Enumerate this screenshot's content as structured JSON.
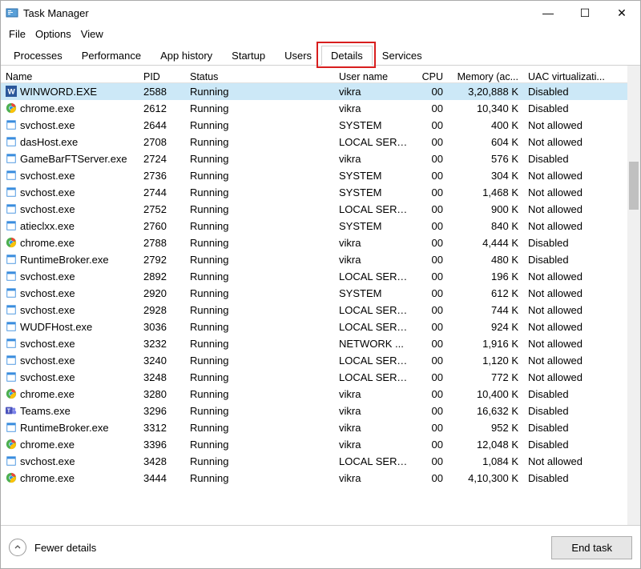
{
  "window": {
    "title": "Task Manager"
  },
  "winctrl": {
    "min": "—",
    "max": "☐",
    "close": "✕"
  },
  "menu": {
    "file": "File",
    "options": "Options",
    "view": "View"
  },
  "tabs": {
    "processes": "Processes",
    "performance": "Performance",
    "apphistory": "App history",
    "startup": "Startup",
    "users": "Users",
    "details": "Details",
    "services": "Services"
  },
  "columns": {
    "name": "Name",
    "pid": "PID",
    "status": "Status",
    "user": "User name",
    "cpu": "CPU",
    "memory": "Memory (ac...",
    "uac": "UAC virtualizati..."
  },
  "footer": {
    "fewer": "Fewer details",
    "endtask": "End task"
  },
  "rows": [
    {
      "icon": "word",
      "name": "WINWORD.EXE",
      "pid": "2588",
      "status": "Running",
      "user": "vikra",
      "cpu": "00",
      "mem": "3,20,888 K",
      "uac": "Disabled",
      "sel": true
    },
    {
      "icon": "chrome",
      "name": "chrome.exe",
      "pid": "2612",
      "status": "Running",
      "user": "vikra",
      "cpu": "00",
      "mem": "10,340 K",
      "uac": "Disabled"
    },
    {
      "icon": "generic",
      "name": "svchost.exe",
      "pid": "2644",
      "status": "Running",
      "user": "SYSTEM",
      "cpu": "00",
      "mem": "400 K",
      "uac": "Not allowed"
    },
    {
      "icon": "generic",
      "name": "dasHost.exe",
      "pid": "2708",
      "status": "Running",
      "user": "LOCAL SERV...",
      "cpu": "00",
      "mem": "604 K",
      "uac": "Not allowed"
    },
    {
      "icon": "generic",
      "name": "GameBarFTServer.exe",
      "pid": "2724",
      "status": "Running",
      "user": "vikra",
      "cpu": "00",
      "mem": "576 K",
      "uac": "Disabled"
    },
    {
      "icon": "generic",
      "name": "svchost.exe",
      "pid": "2736",
      "status": "Running",
      "user": "SYSTEM",
      "cpu": "00",
      "mem": "304 K",
      "uac": "Not allowed"
    },
    {
      "icon": "generic",
      "name": "svchost.exe",
      "pid": "2744",
      "status": "Running",
      "user": "SYSTEM",
      "cpu": "00",
      "mem": "1,468 K",
      "uac": "Not allowed"
    },
    {
      "icon": "generic",
      "name": "svchost.exe",
      "pid": "2752",
      "status": "Running",
      "user": "LOCAL SERV...",
      "cpu": "00",
      "mem": "900 K",
      "uac": "Not allowed"
    },
    {
      "icon": "generic",
      "name": "atieclxx.exe",
      "pid": "2760",
      "status": "Running",
      "user": "SYSTEM",
      "cpu": "00",
      "mem": "840 K",
      "uac": "Not allowed"
    },
    {
      "icon": "chrome",
      "name": "chrome.exe",
      "pid": "2788",
      "status": "Running",
      "user": "vikra",
      "cpu": "00",
      "mem": "4,444 K",
      "uac": "Disabled"
    },
    {
      "icon": "generic",
      "name": "RuntimeBroker.exe",
      "pid": "2792",
      "status": "Running",
      "user": "vikra",
      "cpu": "00",
      "mem": "480 K",
      "uac": "Disabled"
    },
    {
      "icon": "generic",
      "name": "svchost.exe",
      "pid": "2892",
      "status": "Running",
      "user": "LOCAL SERV...",
      "cpu": "00",
      "mem": "196 K",
      "uac": "Not allowed"
    },
    {
      "icon": "generic",
      "name": "svchost.exe",
      "pid": "2920",
      "status": "Running",
      "user": "SYSTEM",
      "cpu": "00",
      "mem": "612 K",
      "uac": "Not allowed"
    },
    {
      "icon": "generic",
      "name": "svchost.exe",
      "pid": "2928",
      "status": "Running",
      "user": "LOCAL SERV...",
      "cpu": "00",
      "mem": "744 K",
      "uac": "Not allowed"
    },
    {
      "icon": "generic",
      "name": "WUDFHost.exe",
      "pid": "3036",
      "status": "Running",
      "user": "LOCAL SERV...",
      "cpu": "00",
      "mem": "924 K",
      "uac": "Not allowed"
    },
    {
      "icon": "generic",
      "name": "svchost.exe",
      "pid": "3232",
      "status": "Running",
      "user": "NETWORK ...",
      "cpu": "00",
      "mem": "1,916 K",
      "uac": "Not allowed"
    },
    {
      "icon": "generic",
      "name": "svchost.exe",
      "pid": "3240",
      "status": "Running",
      "user": "LOCAL SERV...",
      "cpu": "00",
      "mem": "1,120 K",
      "uac": "Not allowed"
    },
    {
      "icon": "generic",
      "name": "svchost.exe",
      "pid": "3248",
      "status": "Running",
      "user": "LOCAL SERV...",
      "cpu": "00",
      "mem": "772 K",
      "uac": "Not allowed"
    },
    {
      "icon": "chrome",
      "name": "chrome.exe",
      "pid": "3280",
      "status": "Running",
      "user": "vikra",
      "cpu": "00",
      "mem": "10,400 K",
      "uac": "Disabled"
    },
    {
      "icon": "teams",
      "name": "Teams.exe",
      "pid": "3296",
      "status": "Running",
      "user": "vikra",
      "cpu": "00",
      "mem": "16,632 K",
      "uac": "Disabled"
    },
    {
      "icon": "generic",
      "name": "RuntimeBroker.exe",
      "pid": "3312",
      "status": "Running",
      "user": "vikra",
      "cpu": "00",
      "mem": "952 K",
      "uac": "Disabled"
    },
    {
      "icon": "chrome",
      "name": "chrome.exe",
      "pid": "3396",
      "status": "Running",
      "user": "vikra",
      "cpu": "00",
      "mem": "12,048 K",
      "uac": "Disabled"
    },
    {
      "icon": "generic",
      "name": "svchost.exe",
      "pid": "3428",
      "status": "Running",
      "user": "LOCAL SERV...",
      "cpu": "00",
      "mem": "1,084 K",
      "uac": "Not allowed"
    },
    {
      "icon": "chrome",
      "name": "chrome.exe",
      "pid": "3444",
      "status": "Running",
      "user": "vikra",
      "cpu": "00",
      "mem": "4,10,300 K",
      "uac": "Disabled"
    }
  ]
}
